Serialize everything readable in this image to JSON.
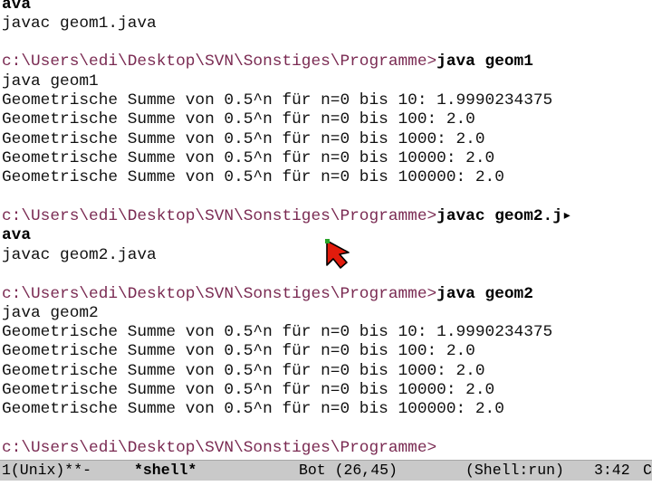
{
  "terminal": {
    "lines": [
      {
        "kind": "bold",
        "text": "ava"
      },
      {
        "kind": "out",
        "text": "javac geom1.java"
      },
      {
        "kind": "blank",
        "text": ""
      },
      {
        "kind": "prompt",
        "prompt": "c:\\Users\\edi\\Desktop\\SVN\\Sonstiges\\Programme>",
        "cmd": "java geom1"
      },
      {
        "kind": "out",
        "text": "java geom1"
      },
      {
        "kind": "out",
        "text": "Geometrische Summe von 0.5^n für n=0 bis 10: 1.9990234375"
      },
      {
        "kind": "out",
        "text": "Geometrische Summe von 0.5^n für n=0 bis 100: 2.0"
      },
      {
        "kind": "out",
        "text": "Geometrische Summe von 0.5^n für n=0 bis 1000: 2.0"
      },
      {
        "kind": "out",
        "text": "Geometrische Summe von 0.5^n für n=0 bis 10000: 2.0"
      },
      {
        "kind": "out",
        "text": "Geometrische Summe von 0.5^n für n=0 bis 100000: 2.0"
      },
      {
        "kind": "blank",
        "text": ""
      },
      {
        "kind": "prompt",
        "prompt": "c:\\Users\\edi\\Desktop\\SVN\\Sonstiges\\Programme>",
        "cmd": "javac geom2.j▸"
      },
      {
        "kind": "bold",
        "text": "ava"
      },
      {
        "kind": "out",
        "text": "javac geom2.java"
      },
      {
        "kind": "blank",
        "text": ""
      },
      {
        "kind": "prompt",
        "prompt": "c:\\Users\\edi\\Desktop\\SVN\\Sonstiges\\Programme>",
        "cmd": "java geom2"
      },
      {
        "kind": "out",
        "text": "java geom2"
      },
      {
        "kind": "out",
        "text": "Geometrische Summe von 0.5^n für n=0 bis 10: 1.9990234375"
      },
      {
        "kind": "out",
        "text": "Geometrische Summe von 0.5^n für n=0 bis 100: 2.0"
      },
      {
        "kind": "out",
        "text": "Geometrische Summe von 0.5^n für n=0 bis 1000: 2.0"
      },
      {
        "kind": "out",
        "text": "Geometrische Summe von 0.5^n für n=0 bis 10000: 2.0"
      },
      {
        "kind": "out",
        "text": "Geometrische Summe von 0.5^n für n=0 bis 100000: 2.0"
      },
      {
        "kind": "blank",
        "text": ""
      },
      {
        "kind": "prompt",
        "prompt": "c:\\Users\\edi\\Desktop\\SVN\\Sonstiges\\Programme>",
        "cmd": ""
      }
    ]
  },
  "cursor_icon": "red-arrow-pointer-icon",
  "colors": {
    "prompt": "#7a2a52",
    "modeline_bg": "#c9c9c9",
    "cursor_fill": "#e21b0c"
  },
  "modeline": {
    "encoding": "1(Unix)**-",
    "buffer": "*shell*",
    "position": "Bot (26,45)",
    "mode": "(Shell:run)",
    "time": "3:42",
    "extra": "C"
  }
}
